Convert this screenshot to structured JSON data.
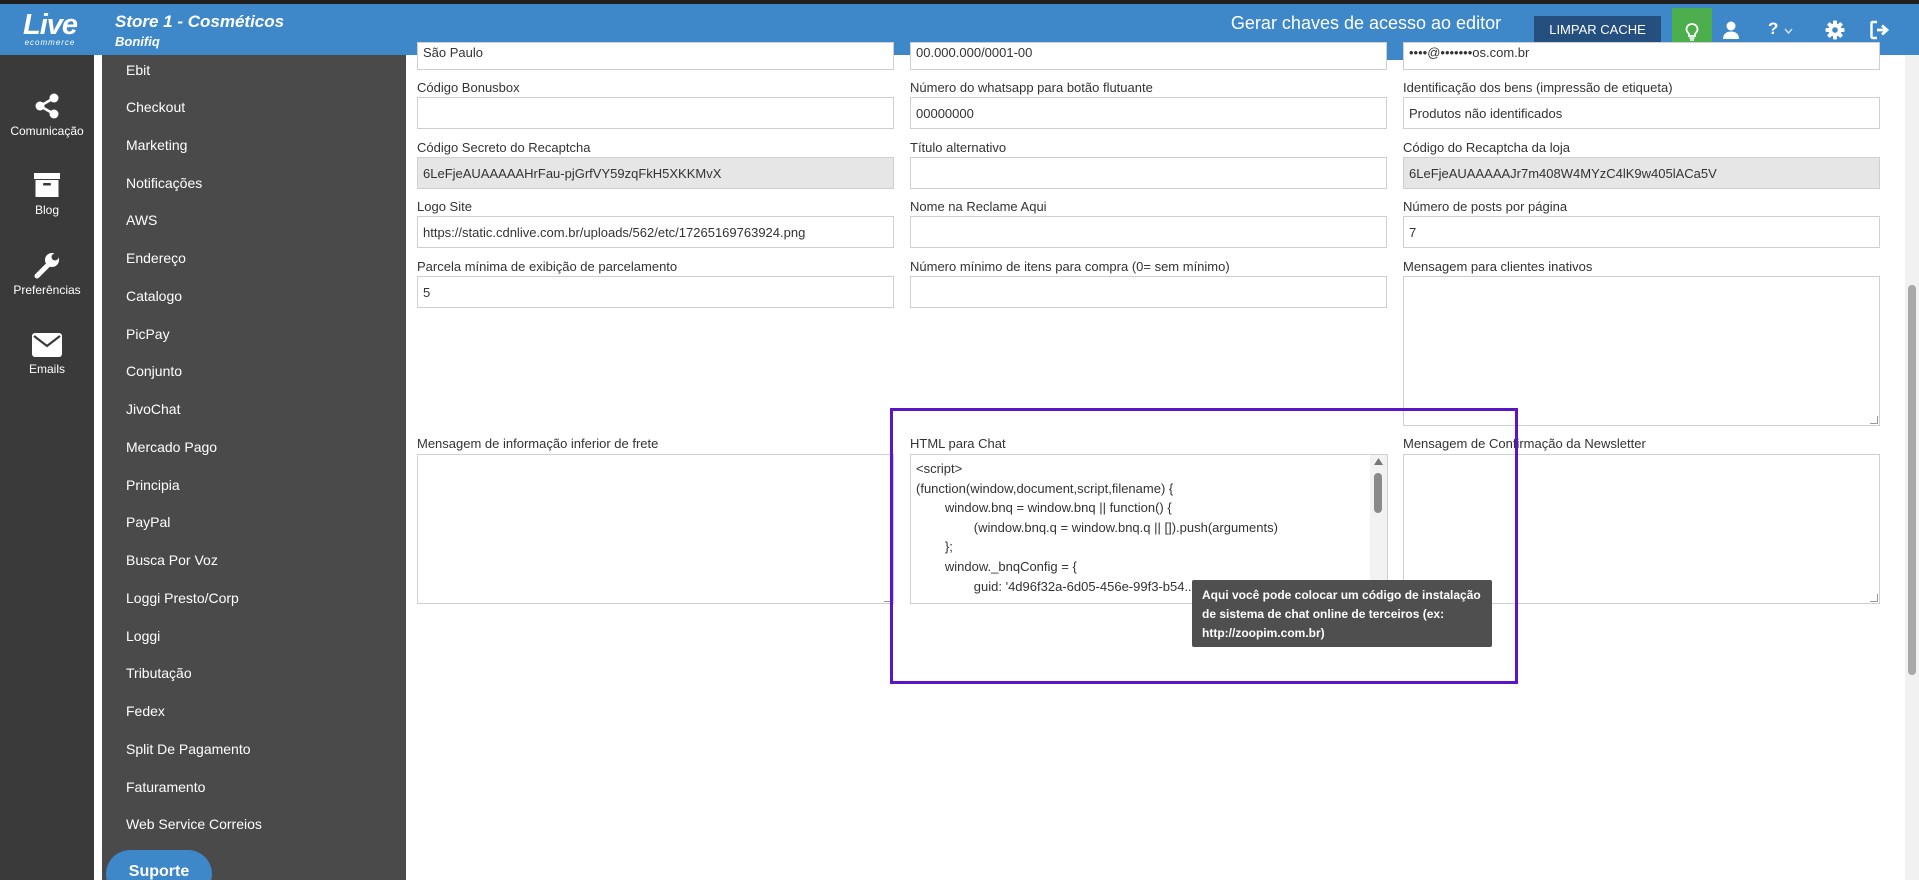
{
  "header": {
    "logo_big": "Live",
    "logo_small": "ecommerce",
    "store_title": "Store 1 - Cosméticos",
    "store_subtitle": "Bonifiq",
    "generate_keys": "Gerar chaves de acesso ao editor",
    "clear_cache": "LIMPAR CACHE",
    "help_label": "?"
  },
  "rail": {
    "items": [
      {
        "label": "Comunicação",
        "icon": "share-icon"
      },
      {
        "label": "Blog",
        "icon": "inbox-icon"
      },
      {
        "label": "Preferências",
        "icon": "wrench-icon"
      },
      {
        "label": "Emails",
        "icon": "envelope-icon"
      }
    ]
  },
  "submenu": {
    "items": [
      "Ebit",
      "Checkout",
      "Marketing",
      "Notificações",
      "AWS",
      "Endereço",
      "Catalogo",
      "PicPay",
      "Conjunto",
      "JivoChat",
      "Mercado Pago",
      "Principia",
      "PayPal",
      "Busca Por Voz",
      "Loggi Presto/Corp",
      "Loggi",
      "Tributação",
      "Fedex",
      "Split De Pagamento",
      "Faturamento",
      "Web Service Correios"
    ],
    "support": "Suporte"
  },
  "form": {
    "top_row": [
      "São Paulo",
      "00.000.000/0001-00",
      "••••@•••••••os.com.br"
    ],
    "codigo_bonusbox": {
      "label": "Código Bonusbox",
      "value": ""
    },
    "whatsapp": {
      "label": "Número do whatsapp para botão flutuante",
      "value": "00000000"
    },
    "identificacao": {
      "label": "Identificação dos bens (impressão de etiqueta)",
      "value": "Produtos não identificados"
    },
    "recaptcha_secret": {
      "label": "Código Secreto do Recaptcha",
      "value": "6LeFjeAUAAAAAHrFau-pjGrfVY59zqFkH5XKKMvX"
    },
    "titulo_alternativo": {
      "label": "Título alternativo",
      "value": ""
    },
    "recaptcha_loja": {
      "label": "Código do Recaptcha da loja",
      "value": "6LeFjeAUAAAAAJr7m408W4MYzC4lK9w405lACa5V"
    },
    "logo_site": {
      "label": "Logo Site",
      "value": "https://static.cdnlive.com.br/uploads/562/etc/17265169763924.png"
    },
    "reclame_aqui": {
      "label": "Nome na Reclame Aqui",
      "value": ""
    },
    "posts_pagina": {
      "label": "Número de posts por página",
      "value": "7"
    },
    "parcela_minima": {
      "label": "Parcela mínima de exibição de parcelamento",
      "value": "5"
    },
    "min_itens": {
      "label": "Número mínimo de itens para compra (0= sem mínimo)",
      "value": ""
    },
    "msg_inativos": {
      "label": "Mensagem para clientes inativos"
    },
    "msg_frete": {
      "label": "Mensagem de informação inferior de frete"
    },
    "html_chat": {
      "label": "HTML para Chat",
      "lines": [
        "<script>",
        "(function(window,document,script,filename) {",
        "        window.bnq = window.bnq || function() {",
        "                (window.bnq.q = window.bnq.q || []).push(arguments)",
        "        };",
        "",
        "        window._bnqConfig = {",
        "                guid: '4d96f32a-6d05-456e-99f3-b54...'"
      ]
    },
    "msg_newsletter": {
      "label": "Mensagem de Confirmação da Newsletter"
    },
    "tooltip": "Aqui você pode colocar um código de instalação de sistema de chat online de terceiros (ex: http://zoopim.com.br)"
  }
}
